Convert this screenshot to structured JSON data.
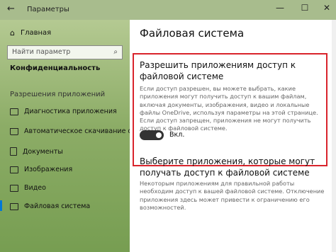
{
  "window": {
    "title": "Параметры",
    "back_icon": "←",
    "minimize": "—",
    "maximize": "☐",
    "close": "✕"
  },
  "sidebar": {
    "home_label": "Главная",
    "search_placeholder": "Найти параметр",
    "section_title": "Конфиденциальность",
    "group_label": "Разрешения приложений",
    "items": [
      {
        "label": "Диагностика приложения",
        "icon": "diagnostics-icon"
      },
      {
        "label": "Автоматическое скачивание файлов",
        "icon": "download-icon"
      },
      {
        "label": "Документы",
        "icon": "document-icon"
      },
      {
        "label": "Изображения",
        "icon": "image-icon"
      },
      {
        "label": "Видео",
        "icon": "video-icon"
      },
      {
        "label": "Файловая система",
        "icon": "file-system-icon"
      }
    ]
  },
  "main": {
    "page_title": "Файловая система",
    "card_heading": "Разрешить приложениям доступ к файловой системе",
    "card_description": "Если доступ разрешен, вы можете выбрать, какие приложения могут получить доступ к вашим файлам, включая документы, изображения, видео и локальные файлы OneDrive, используя параметры на этой странице. Если доступ запрещен, приложения не могут получить доступ к файловой системе.",
    "toggle_state_label": "Вкл.",
    "toggle_on": true,
    "section2_heading": "Выберите приложения, которые могут получать доступ к файловой системе",
    "section2_description": "Некоторым приложениям для правильной работы необходим доступ к вашей файловой системе. Отключение приложения здесь может привести к ограничению его возможностей."
  },
  "colors": {
    "accent": "#0078d7",
    "highlight_border": "#d9242c"
  }
}
